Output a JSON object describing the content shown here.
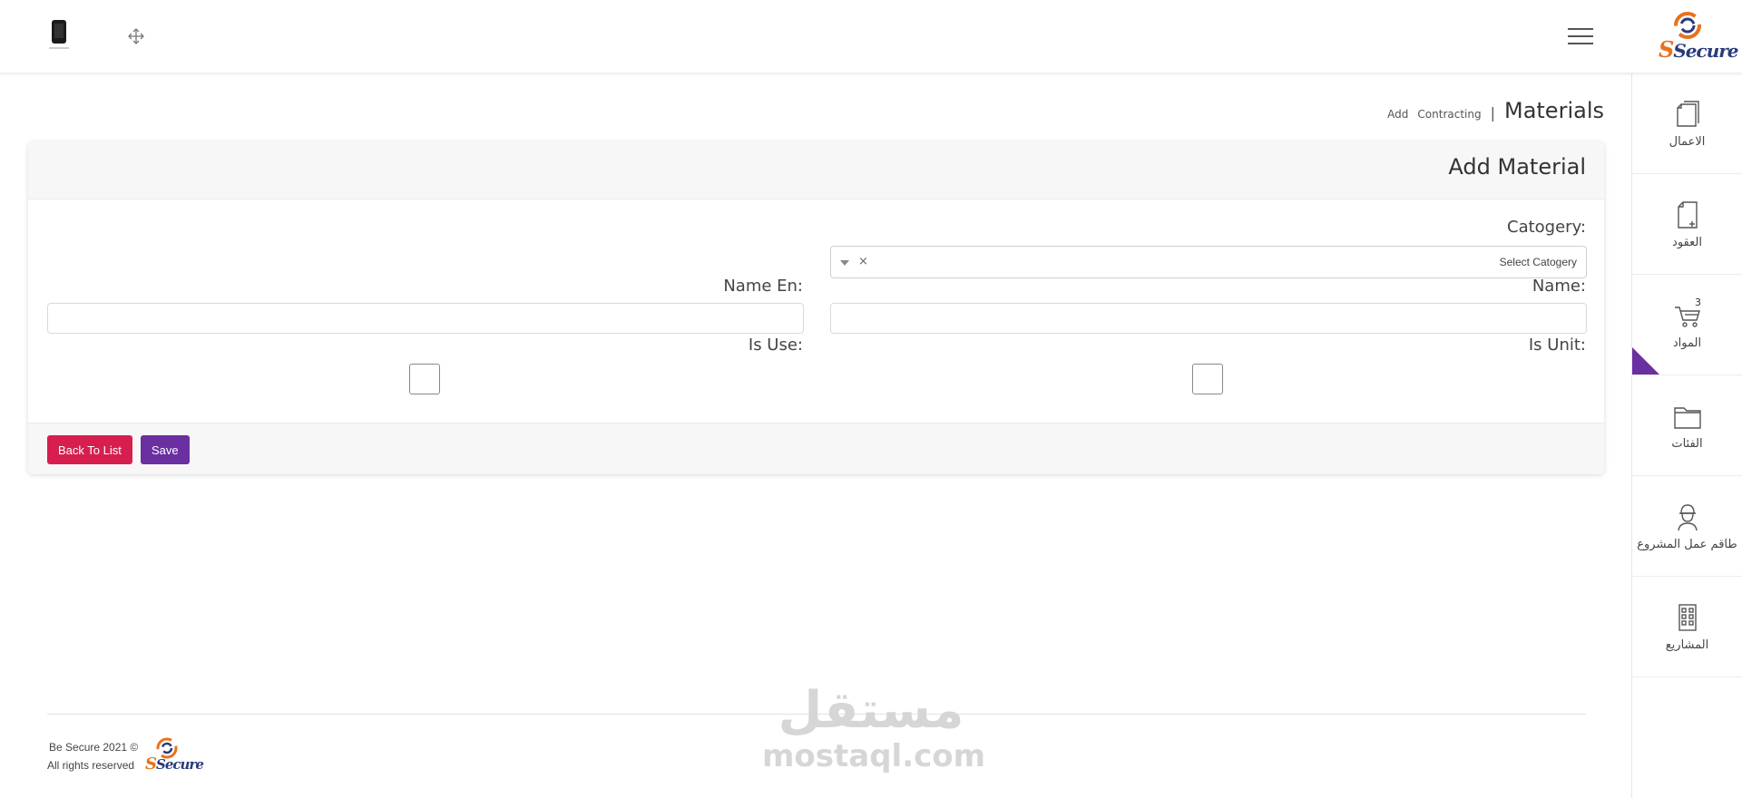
{
  "header": {
    "device_icon": "tablet-icon",
    "expand_icon": "expand-arrows-icon",
    "menu_icon": "hamburger-menu-icon",
    "logo_text": "Secure"
  },
  "sidebar": {
    "items": [
      {
        "label": "الاعمال",
        "icon": "document-stack-icon"
      },
      {
        "label": "العقود",
        "icon": "document-add-icon"
      },
      {
        "label": "المواد",
        "icon": "cart-icon",
        "badge": "3",
        "active": true
      },
      {
        "label": "الفئات",
        "icon": "folder-icon"
      },
      {
        "label": "طاقم عمل المشروع",
        "icon": "worker-icon"
      },
      {
        "label": "المشاريع",
        "icon": "building-icon"
      }
    ]
  },
  "breadcrumb": {
    "add": "Add",
    "section": "Contracting",
    "separator": "|",
    "title": "Materials"
  },
  "card": {
    "title": "Add Material",
    "category_label": "Catogery:",
    "category_placeholder": "Select Catogery",
    "category_clear": "×",
    "name_label": "Name:",
    "name_en_label": "Name En:",
    "is_unit_label": "Is Unit:",
    "is_use_label": "Is Use:",
    "name_value": "",
    "name_en_value": ""
  },
  "buttons": {
    "back": "Back To List",
    "save": "Save"
  },
  "footer": {
    "copyright_line1": "Be Secure 2021 ©",
    "copyright_line2": "All rights reserved",
    "logo_text": "Secure"
  },
  "watermark": {
    "arabic": "مستقل",
    "latin": "mostaql.com"
  },
  "colors": {
    "accent": "#6a2fa0",
    "danger": "#d61f4f",
    "logo_blue": "#2a3b7a",
    "logo_orange": "#e8721c"
  }
}
